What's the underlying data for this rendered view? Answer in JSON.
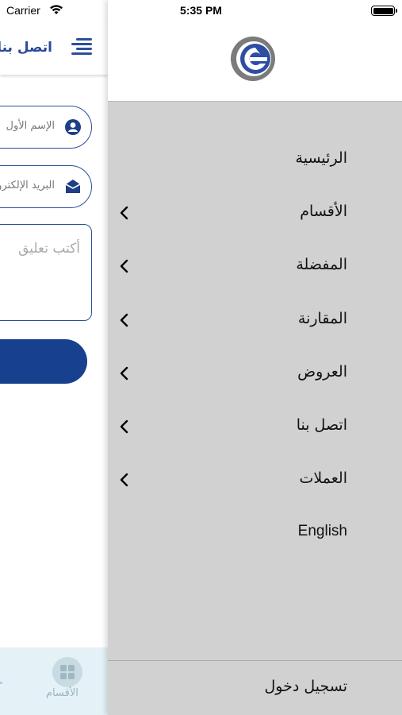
{
  "status_bar": {
    "carrier": "Carrier",
    "time": "5:35 PM"
  },
  "page": {
    "title": "اتصل بنا",
    "first_name_placeholder": "الإسم الأول",
    "email_placeholder": "البريد الإلكتروني",
    "comment_placeholder": "أكتب تعليق",
    "accent_color": "#17408f",
    "tab_label": "الأقسام"
  },
  "drawer": {
    "logo": "brand-logo-icon",
    "menu_items": [
      {
        "label": "الرئيسية",
        "has_submenu": false
      },
      {
        "label": "الأقسام",
        "has_submenu": true
      },
      {
        "label": "المفضلة",
        "has_submenu": true
      },
      {
        "label": "المقارنة",
        "has_submenu": true
      },
      {
        "label": "العروض",
        "has_submenu": true
      },
      {
        "label": "اتصل بنا",
        "has_submenu": true
      },
      {
        "label": "العملات",
        "has_submenu": true
      },
      {
        "label": "English",
        "has_submenu": false
      }
    ],
    "login_label": "تسجيل دخول",
    "background_color": "#d2d1d2"
  }
}
